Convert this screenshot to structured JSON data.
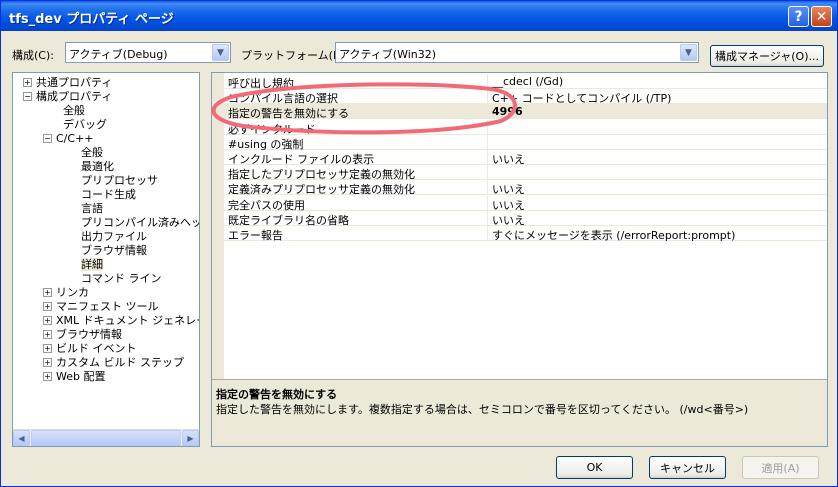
{
  "window": {
    "title": "tfs_dev プロパティ ページ"
  },
  "titlebar": {
    "help": "?",
    "close": "✕"
  },
  "config": {
    "label": "構成(C):",
    "value": "アクティブ(Debug)",
    "platform_label": "プラットフォーム(P):",
    "platform_value": "アクティブ(Win32)",
    "manager_label": "構成マネージャ(O)..."
  },
  "icons": {
    "dropdown": "chevron-down-icon",
    "expand": "plus-box-icon",
    "collapse": "minus-box-icon"
  },
  "tree": {
    "items": [
      {
        "label": "共通プロパティ",
        "exp": "+"
      },
      {
        "label": "構成プロパティ",
        "exp": "−"
      },
      {
        "label": "全般"
      },
      {
        "label": "デバッグ"
      },
      {
        "label": "C/C++",
        "exp": "−"
      },
      {
        "label": "全般"
      },
      {
        "label": "最適化"
      },
      {
        "label": "プリプロセッサ"
      },
      {
        "label": "コード生成"
      },
      {
        "label": "言語"
      },
      {
        "label": "プリコンパイル済みヘッダー"
      },
      {
        "label": "出力ファイル"
      },
      {
        "label": "ブラウザ情報"
      },
      {
        "label": "詳細"
      },
      {
        "label": "コマンド ライン"
      },
      {
        "label": "リンカ",
        "exp": "+"
      },
      {
        "label": "マニフェスト ツール",
        "exp": "+"
      },
      {
        "label": "XML ドキュメント ジェネレータ",
        "exp": "+"
      },
      {
        "label": "ブラウザ情報",
        "exp": "+"
      },
      {
        "label": "ビルド イベント",
        "exp": "+"
      },
      {
        "label": "カスタム ビルド ステップ",
        "exp": "+"
      },
      {
        "label": "Web 配置",
        "exp": "+"
      }
    ]
  },
  "grid": {
    "rows": [
      {
        "name": "呼び出し規約",
        "value": "__cdecl (/Gd)"
      },
      {
        "name": "コンパイル言語の選択",
        "value": "C++ コードとしてコンパイル (/TP)"
      },
      {
        "name": "指定の警告を無効にする",
        "value": "4996"
      },
      {
        "name": "必ずインクルード",
        "value": ""
      },
      {
        "name": "#using の強制",
        "value": ""
      },
      {
        "name": "インクルード ファイルの表示",
        "value": "いいえ"
      },
      {
        "name": "指定したプリプロセッサ定義の無効化",
        "value": ""
      },
      {
        "name": "定義済みプリプロセッサ定義の無効化",
        "value": "いいえ"
      },
      {
        "name": "完全パスの使用",
        "value": "いいえ"
      },
      {
        "name": "既定ライブラリ名の省略",
        "value": "いいえ"
      },
      {
        "name": "エラー報告",
        "value": "すぐにメッセージを表示 (/errorReport:prompt)"
      }
    ]
  },
  "description": {
    "title": "指定の警告を無効にする",
    "text": "指定した警告を無効にします。複数指定する場合は、セミコロンで番号を区切ってください。    (/wd<番号>)"
  },
  "buttons": {
    "ok": "OK",
    "cancel": "キャンセル",
    "apply": "適用(A)"
  },
  "colors": {
    "title_bar": "#0055e5",
    "annotation": "#f06a78",
    "dialog_bg": "#ece9d8"
  }
}
